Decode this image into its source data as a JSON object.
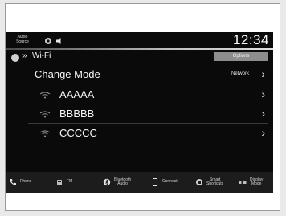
{
  "status": {
    "audio_source_line1": "Audio",
    "audio_source_line2": "Source",
    "clock": "12:34"
  },
  "header": {
    "title": "Wi-Fi",
    "options_label": "Options"
  },
  "list": {
    "change_mode": {
      "label": "Change Mode",
      "value": "Network"
    },
    "networks": [
      {
        "ssid": "AAAAA"
      },
      {
        "ssid": "BBBBB"
      },
      {
        "ssid": "CCCCC"
      }
    ]
  },
  "bottom_bar": {
    "items": [
      {
        "label": "Phone",
        "icon": "phone-icon"
      },
      {
        "label": "FM",
        "icon": "radio-icon"
      },
      {
        "label_line1": "Bluetooth",
        "label_line2": "Audio",
        "icon": "bluetooth-icon"
      },
      {
        "label": "Connect",
        "icon": "smartphone-icon"
      },
      {
        "label_line1": "Smart",
        "label_line2": "Shortcuts",
        "icon": "shortcuts-icon"
      },
      {
        "label_line1": "Display",
        "label_line2": "Mode",
        "icon": "display-mode-icon"
      }
    ]
  },
  "colors": {
    "screen_bg": "#0a0a0a",
    "options_button": "#8d8d8d",
    "bottom_bar": "#1c1c1c"
  }
}
